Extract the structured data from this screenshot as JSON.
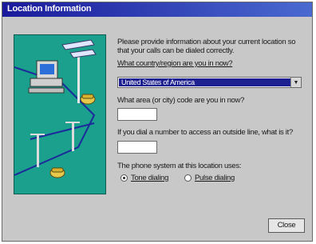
{
  "window": {
    "title": "Location Information"
  },
  "intro": {
    "line1": "Please provide information about your current location so",
    "line2": "that your calls can be dialed correctly."
  },
  "country": {
    "label": "What country/region are you in now?",
    "value": "United States of America"
  },
  "area_code": {
    "label": "What area (or city) code are you in now?",
    "value": ""
  },
  "outside_line": {
    "label": "If you dial a number to access an outside line, what is it?",
    "value": ""
  },
  "phone_system": {
    "label": "The phone system at this location uses:",
    "options": [
      {
        "label": "Tone dialing",
        "selected": true
      },
      {
        "label": "Pulse dialing",
        "selected": false
      }
    ]
  },
  "buttons": {
    "close": "Close"
  },
  "icons": {
    "illustration": "telephone-network-illustration",
    "dropdown": "chevron-down-icon"
  },
  "colors": {
    "title_bar": "#1a1a9a",
    "illustration_bg": "#1aa08c",
    "selection": "#1c2090"
  }
}
